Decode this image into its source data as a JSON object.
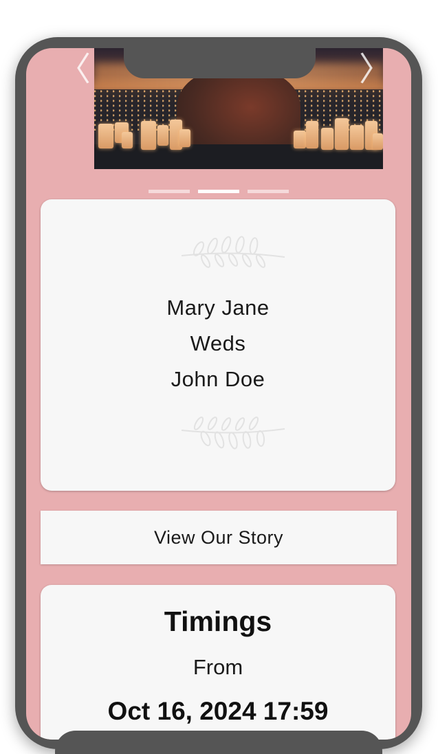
{
  "carousel": {
    "prev_icon": "chevron-left-icon",
    "next_icon": "chevron-right-icon",
    "prev_glyph": "〈",
    "next_glyph": "〉",
    "slide_count": 3,
    "active_slide": 2
  },
  "couple": {
    "bride": "Mary Jane",
    "connector": "Weds",
    "groom": "John Doe"
  },
  "story_button": {
    "label": "View Our Story"
  },
  "timings": {
    "title": "Timings",
    "from_label": "From",
    "start_datetime": "Oct 16, 2024 17:59"
  },
  "colors": {
    "background": "#e8aeb0",
    "card": "#f7f7f7",
    "phone_frame": "#555555"
  }
}
